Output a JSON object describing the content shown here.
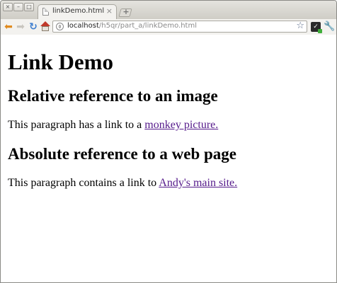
{
  "browser": {
    "tab": {
      "title": "linkDemo.html",
      "close_glyph": "×"
    },
    "window_controls": [
      "×",
      "–",
      "□"
    ],
    "toolbar": {
      "back_icon": "back-arrow-icon",
      "forward_icon": "forward-arrow-icon",
      "reload_icon": "reload-icon",
      "home_icon": "home-icon",
      "star_icon": "bookmark-star-icon",
      "wrench_icon": "wrench-icon",
      "extension_icon": "extension-icon"
    },
    "address_bar": {
      "host": "localhost",
      "path": "/h5qr/part_a/linkDemo.html"
    }
  },
  "page": {
    "title": "Link Demo",
    "sections": [
      {
        "heading": "Relative reference to an image",
        "text": "This paragraph has a link to a ",
        "link_text": "monkey picture."
      },
      {
        "heading": "Absolute reference to a web page",
        "text": "This paragraph contains a link to ",
        "link_text": "Andy's main site."
      }
    ]
  },
  "colors": {
    "visited_link": "#551a8b",
    "back_arrow": "#e08a1e",
    "reload": "#3f7fcf"
  }
}
